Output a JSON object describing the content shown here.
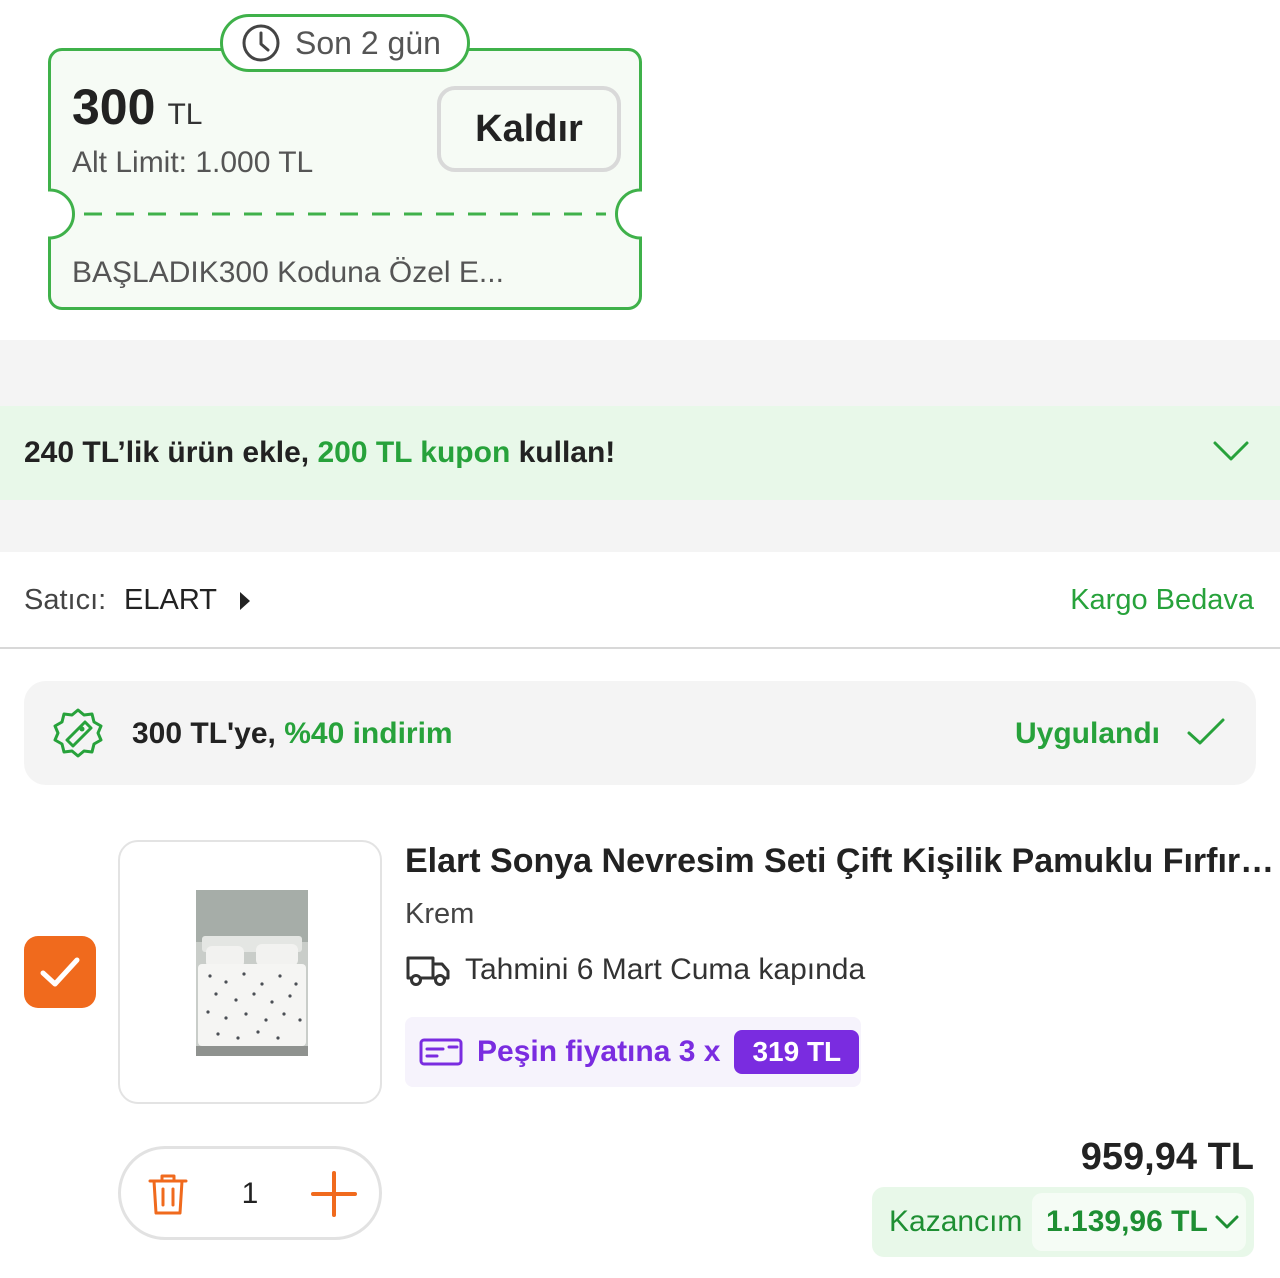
{
  "coupon": {
    "deadline": "Son 2 gün",
    "amount": "300",
    "currency": "TL",
    "limit": "Alt Limit: 1.000 TL",
    "remove_label": "Kaldır",
    "description": "BAŞLADIK300 Koduna Özel E...",
    "accent_color": "#3fb14a",
    "background_color": "#f6fbf5"
  },
  "promo": {
    "text_before": "240 TL’lik ürün ekle, ",
    "text_highlight": "200 TL kupon",
    "text_after": " kullan!",
    "icon": "chevron-down-icon"
  },
  "seller": {
    "label": "Satıcı:",
    "name": "ELART",
    "shipping": "Kargo Bedava"
  },
  "discount": {
    "text_before": "300 TL'ye, ",
    "text_highlight": "%40 indirim",
    "status": "Uygulandı",
    "icon": "discount-badge-icon"
  },
  "product": {
    "title": "Elart Sonya Nevresim Seti Çift Kişilik Pamuklu Fırfırlı Kr...",
    "variant": "Krem",
    "delivery": "Tahmini 6 Mart Cuma kapında",
    "installment_text": "Peşin fiyatına 3 x",
    "installment_amount": "319 TL",
    "selected": true,
    "quantity": "1",
    "price": "959,94 TL",
    "savings_label": "Kazancım",
    "savings_amount": "1.139,96 TL"
  },
  "colors": {
    "green": "#27a23b",
    "orange": "#f06a1d",
    "purple": "#7a2ce0"
  }
}
